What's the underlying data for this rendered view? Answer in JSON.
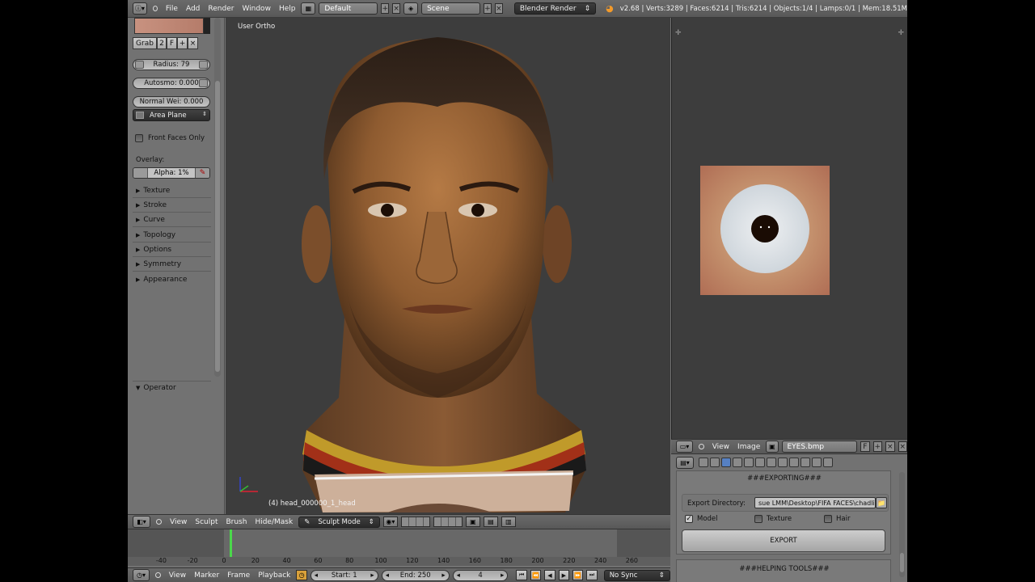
{
  "topbar": {
    "menus": [
      "File",
      "Add",
      "Render",
      "Window",
      "Help"
    ],
    "layout": "Default",
    "scene": "Scene",
    "render_engine": "Blender Render",
    "info": "v2.68 | Verts:3289 | Faces:6214 | Tris:6214 | Objects:1/4 | Lamps:0/1 | Mem:18.51M"
  },
  "tools": {
    "brush_name": "Grab",
    "brush_users": "2",
    "brush_fake": "F",
    "radius": "Radius: 79",
    "autosmooth": "Autosmo: 0.000",
    "normal_weight": "Normal Wei: 0.000",
    "area_plane": "Area Plane",
    "front_faces": "Front Faces Only",
    "overlay_label": "Overlay:",
    "overlay_alpha": "Alpha: 1%",
    "panels": [
      "Texture",
      "Stroke",
      "Curve",
      "Topology",
      "Options",
      "Symmetry",
      "Appearance"
    ],
    "operator": "Operator"
  },
  "viewport": {
    "label": "User Ortho",
    "object": "(4) head_000000_1_head"
  },
  "viewport_header": {
    "menus": [
      "View",
      "Sculpt",
      "Brush",
      "Hide/Mask"
    ],
    "mode": "Sculpt Mode"
  },
  "timeline": {
    "ticks": [
      "-40",
      "-20",
      "0",
      "20",
      "40",
      "60",
      "80",
      "100",
      "120",
      "140",
      "160",
      "180",
      "200",
      "220",
      "240",
      "260"
    ],
    "menus": [
      "View",
      "Marker",
      "Frame",
      "Playback"
    ],
    "start": "Start: 1",
    "end": "End: 250",
    "current": "4",
    "sync": "No Sync",
    "current_frame_value": 4
  },
  "image_editor": {
    "menus": [
      "View",
      "Image"
    ],
    "image_name": "EYES.bmp",
    "fake": "F"
  },
  "export": {
    "header": "###EXPORTING###",
    "dir_label": "Export Directory:",
    "dir_value": "sue LMM\\Desktop\\FIFA FACES\\chadli\\",
    "options": [
      {
        "label": "Model",
        "checked": true
      },
      {
        "label": "Texture",
        "checked": false
      },
      {
        "label": "Hair",
        "checked": false
      }
    ],
    "button": "EXPORT",
    "helping_header": "###HELPING TOOLS###"
  },
  "colors": {
    "panel_bg": "#727272",
    "viewport_bg": "#3d3d3d",
    "accent_blue": "#5680c2",
    "frame_cursor": "#4bd84b"
  }
}
